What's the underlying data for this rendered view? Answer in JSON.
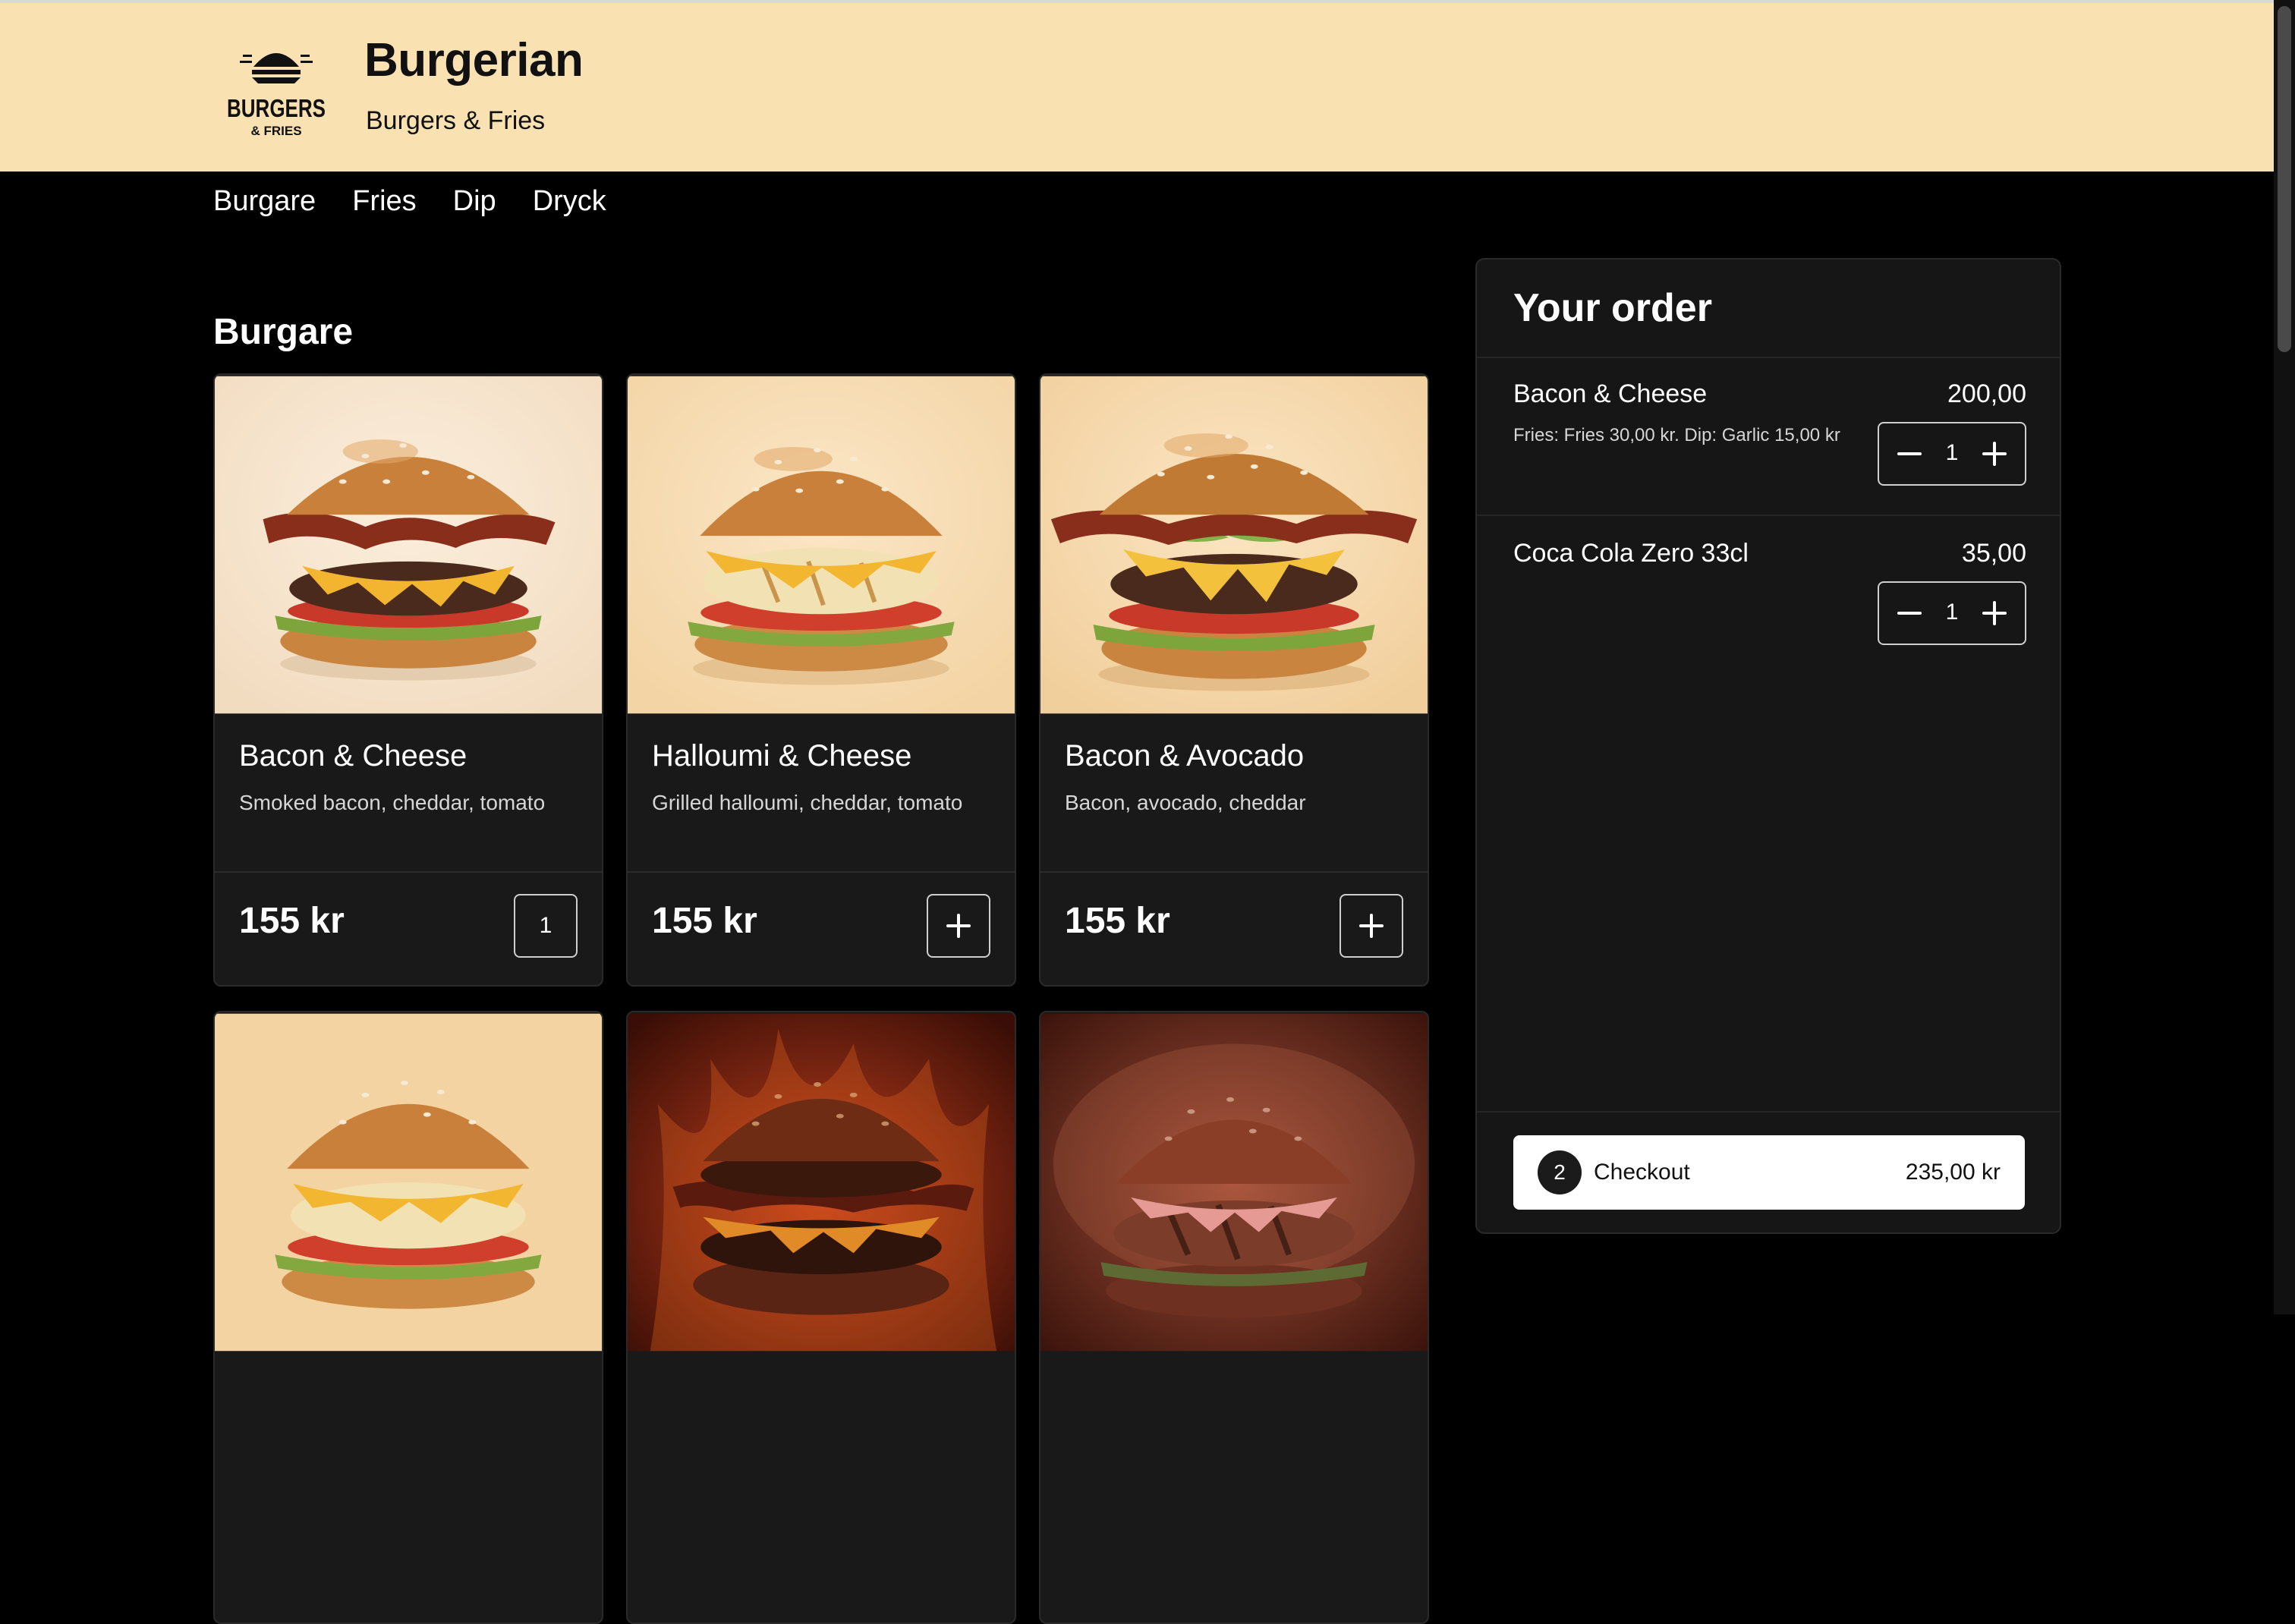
{
  "header": {
    "logo_text": "BURGERS",
    "logo_sub": "& FRIES",
    "title": "Burgerian",
    "subtitle": "Burgers & Fries"
  },
  "nav": [
    "Burgare",
    "Fries",
    "Dip",
    "Dryck"
  ],
  "section": {
    "title": "Burgare"
  },
  "products": [
    {
      "name": "Bacon & Cheese",
      "description": "Smoked bacon, cheddar, tomato",
      "price": "155 kr",
      "button": "1",
      "in_cart": true,
      "image": "burger-bacon-cheese"
    },
    {
      "name": "Halloumi & Cheese",
      "description": "Grilled halloumi, cheddar, tomato",
      "price": "155 kr",
      "button": "+",
      "in_cart": false,
      "image": "burger-halloumi-cheese"
    },
    {
      "name": "Bacon & Avocado",
      "description": "Bacon, avocado, cheddar",
      "price": "155 kr",
      "button": "+",
      "in_cart": false,
      "image": "burger-bacon-avocado"
    },
    {
      "image": "burger-halloumi"
    },
    {
      "image": "burger-fire"
    },
    {
      "image": "burger-smoke"
    }
  ],
  "order": {
    "title": "Your order",
    "items": [
      {
        "name": "Bacon & Cheese",
        "price": "200,00",
        "options": "Fries: Fries 30,00 kr. Dip: Garlic 15,00 kr",
        "qty": "1"
      },
      {
        "name": "Coca Cola Zero 33cl",
        "price": "35,00",
        "options": "",
        "qty": "1"
      }
    ],
    "checkout": {
      "count": "2",
      "label": "Checkout",
      "total": "235,00 kr"
    }
  },
  "colors": {
    "header_bg": "#f9e1b2",
    "page_bg": "#000000",
    "card_bg": "#191919",
    "panel_bg": "#161616",
    "checkout_bg": "#ffffff"
  }
}
